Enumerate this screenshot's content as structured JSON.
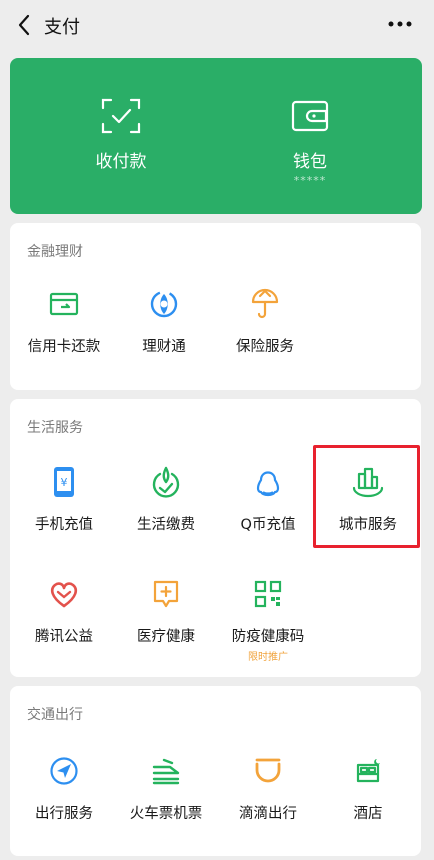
{
  "header": {
    "title": "支付",
    "back_icon": "chevron-left-icon",
    "more_icon": "more-dots-icon"
  },
  "wallet_panel": {
    "background_color": "#2aae67",
    "items": [
      {
        "label": "收付款",
        "icon": "scan-frame-icon",
        "sub": ""
      },
      {
        "label": "钱包",
        "icon": "wallet-icon",
        "sub": "*****"
      }
    ]
  },
  "sections": [
    {
      "title": "金融理财",
      "items": [
        {
          "label": "信用卡还款",
          "icon": "credit-card-icon",
          "color": "#24b35d"
        },
        {
          "label": "理财通",
          "icon": "licaitong-icon",
          "color": "#2d8ff0"
        },
        {
          "label": "保险服务",
          "icon": "insurance-umbrella-icon",
          "color": "#f3a33a"
        }
      ]
    },
    {
      "title": "生活服务",
      "items": [
        {
          "label": "手机充值",
          "icon": "phone-recharge-icon",
          "color": "#2d8ff0"
        },
        {
          "label": "生活缴费",
          "icon": "utility-payment-icon",
          "color": "#24b35d"
        },
        {
          "label": "Q币充值",
          "icon": "qq-penguin-icon",
          "color": "#2d8ff0"
        },
        {
          "label": "城市服务",
          "icon": "city-buildings-icon",
          "color": "#24b35d"
        },
        {
          "label": "腾讯公益",
          "icon": "charity-heart-icon",
          "color": "#e3524c"
        },
        {
          "label": "医疗健康",
          "icon": "medical-box-icon",
          "color": "#f3a33a"
        },
        {
          "label": "防疫健康码",
          "icon": "health-qr-code-icon",
          "color": "#24b35d",
          "tag": "限时推广"
        }
      ]
    },
    {
      "title": "交通出行",
      "items": [
        {
          "label": "出行服务",
          "icon": "navigation-arrow-icon",
          "color": "#2d8ff0"
        },
        {
          "label": "火车票机票",
          "icon": "train-plane-icon",
          "color": "#24b35d"
        },
        {
          "label": "滴滴出行",
          "icon": "didi-icon",
          "color": "#f3a33a"
        },
        {
          "label": "酒店",
          "icon": "hotel-bed-icon",
          "color": "#24b35d"
        }
      ]
    }
  ],
  "highlight": {
    "target": "城市服务",
    "color": "#e8212e"
  }
}
